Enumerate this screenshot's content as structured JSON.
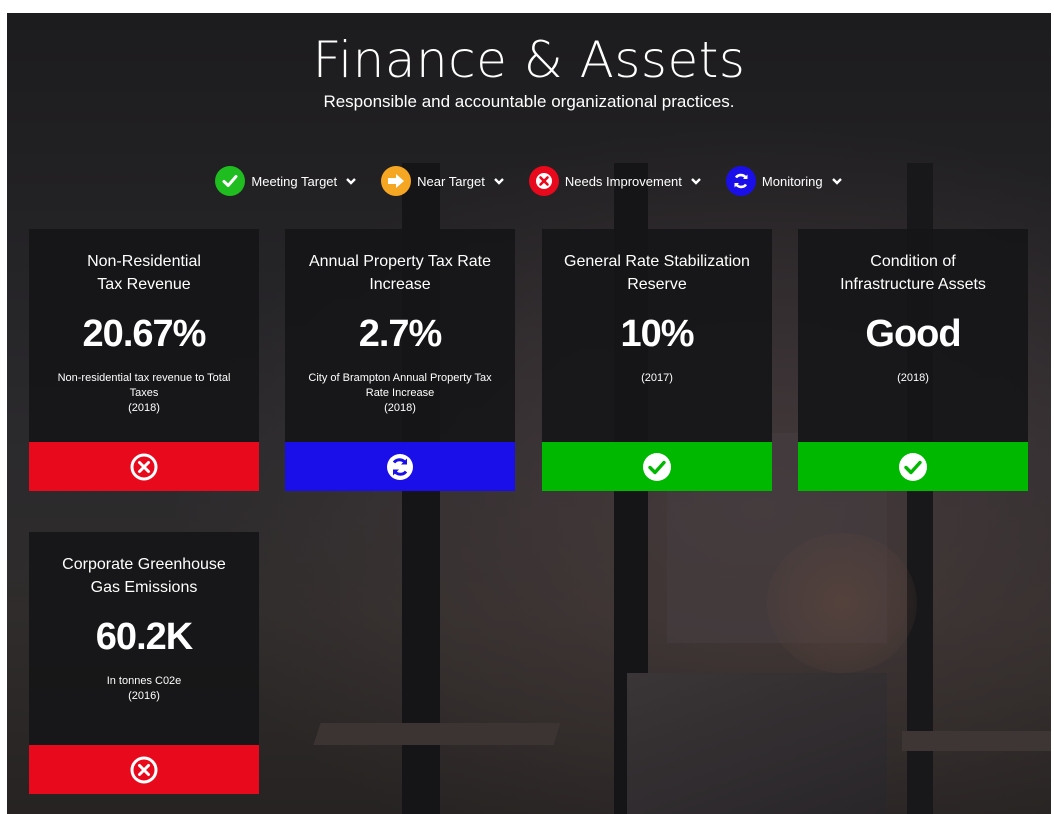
{
  "header": {
    "title": "Finance & Assets",
    "subtitle": "Responsible and accountable organizational practices."
  },
  "legend": [
    {
      "label": "Meeting Target",
      "icon": "check-icon",
      "color": "#1fbd1f"
    },
    {
      "label": "Near Target",
      "icon": "arrow-right-icon",
      "color": "#f5a623"
    },
    {
      "label": "Needs Improvement",
      "icon": "x-circle-icon",
      "color": "#e8091c"
    },
    {
      "label": "Monitoring",
      "icon": "refresh-icon",
      "color": "#1a0fe8"
    }
  ],
  "cards": [
    {
      "title_line1": "Non-Residential",
      "title_line2": "Tax Revenue",
      "value": "20.67%",
      "desc_line1": "Non-residential tax revenue to Total",
      "desc_line2": "Taxes",
      "desc_line3": "(2018)",
      "status": "Needs Improvement",
      "status_color": "#e8091c",
      "status_icon": "x-circle-icon"
    },
    {
      "title_line1": "Annual Property Tax Rate",
      "title_line2": "Increase",
      "value": "2.7%",
      "desc_line1": "City of Brampton Annual Property Tax",
      "desc_line2": "Rate Increase",
      "desc_line3": "(2018)",
      "status": "Monitoring",
      "status_color": "#1a0fe8",
      "status_icon": "refresh-icon"
    },
    {
      "title_line1": "General Rate Stabilization",
      "title_line2": "Reserve",
      "value": "10%",
      "desc_line1": "(2017)",
      "desc_line2": "",
      "desc_line3": "",
      "status": "Meeting Target",
      "status_color": "#00b800",
      "status_icon": "check-icon"
    },
    {
      "title_line1": "Condition of",
      "title_line2": "Infrastructure Assets",
      "value": "Good",
      "desc_line1": "(2018)",
      "desc_line2": "",
      "desc_line3": "",
      "status": "Meeting Target",
      "status_color": "#00b800",
      "status_icon": "check-icon"
    },
    {
      "title_line1": "Corporate Greenhouse",
      "title_line2": "Gas Emissions",
      "value": "60.2K",
      "desc_line1": "In tonnes C02e",
      "desc_line2": "(2016)",
      "desc_line3": "",
      "status": "Needs Improvement",
      "status_color": "#e8091c",
      "status_icon": "x-circle-icon"
    }
  ]
}
